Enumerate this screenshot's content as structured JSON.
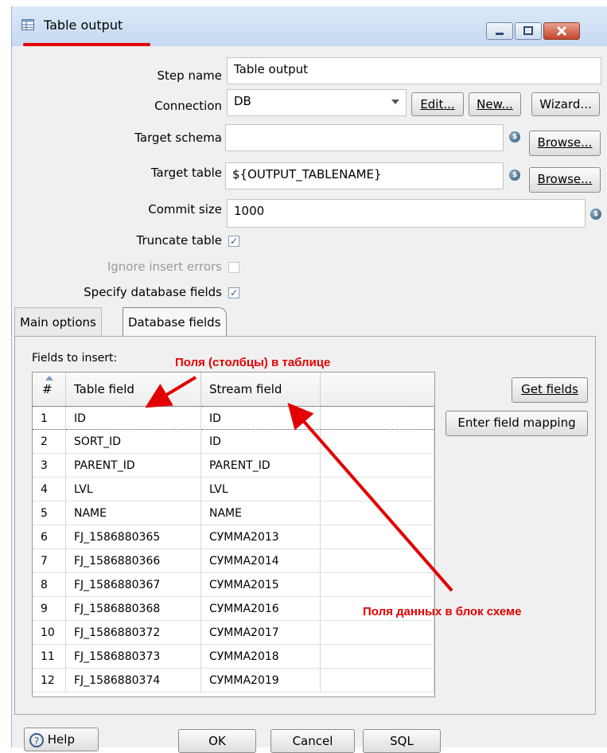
{
  "window": {
    "title": "Table output"
  },
  "form": {
    "step_name_label": "Step name",
    "step_name_value": "Table output",
    "connection_label": "Connection",
    "connection_value": "DB",
    "edit_button": "Edit...",
    "new_button": "New...",
    "wizard_button": "Wizard...",
    "target_schema_label": "Target schema",
    "target_schema_value": "",
    "browse_button": "Browse...",
    "target_table_label": "Target table",
    "target_table_value": "${OUTPUT_TABLENAME}",
    "commit_size_label": "Commit size",
    "commit_size_value": "1000",
    "truncate_label": "Truncate table",
    "truncate_checked": true,
    "ignore_errors_label": "Ignore insert errors",
    "ignore_errors_checked": false,
    "specify_fields_label": "Specify database fields",
    "specify_fields_checked": true
  },
  "tabs": [
    {
      "label": "Main options",
      "active": false
    },
    {
      "label": "Database fields",
      "active": true
    }
  ],
  "fields_panel": {
    "fields_label": "Fields to insert:",
    "get_fields_button": "Get fields",
    "mapping_button": "Enter field mapping",
    "columns": [
      "#",
      "Table field",
      "Stream field"
    ],
    "rows": [
      {
        "n": "1",
        "table": "ID",
        "stream": "ID"
      },
      {
        "n": "2",
        "table": "SORT_ID",
        "stream": "ID"
      },
      {
        "n": "3",
        "table": "PARENT_ID",
        "stream": "PARENT_ID"
      },
      {
        "n": "4",
        "table": "LVL",
        "stream": "LVL"
      },
      {
        "n": "5",
        "table": "NAME",
        "stream": "NAME"
      },
      {
        "n": "6",
        "table": "FJ_1586880365",
        "stream": "СУММА2013"
      },
      {
        "n": "7",
        "table": "FJ_1586880366",
        "stream": "СУММА2014"
      },
      {
        "n": "8",
        "table": "FJ_1586880367",
        "stream": "СУММА2015"
      },
      {
        "n": "9",
        "table": "FJ_1586880368",
        "stream": "СУММА2016"
      },
      {
        "n": "10",
        "table": "FJ_1586880372",
        "stream": "СУММА2017"
      },
      {
        "n": "11",
        "table": "FJ_1586880373",
        "stream": "СУММА2018"
      },
      {
        "n": "12",
        "table": "FJ_1586880374",
        "stream": "СУММА2019"
      }
    ]
  },
  "annotations": {
    "table_columns_note": "Поля (столбцы) в таблице",
    "stream_fields_note": "Поля данных в блок схеме",
    "color": "#e30000"
  },
  "footer": {
    "help_button": "Help",
    "ok_button": "OK",
    "cancel_button": "Cancel",
    "sql_button": "SQL"
  },
  "icons": {
    "variable": "$",
    "check": "✓",
    "help": "?"
  }
}
